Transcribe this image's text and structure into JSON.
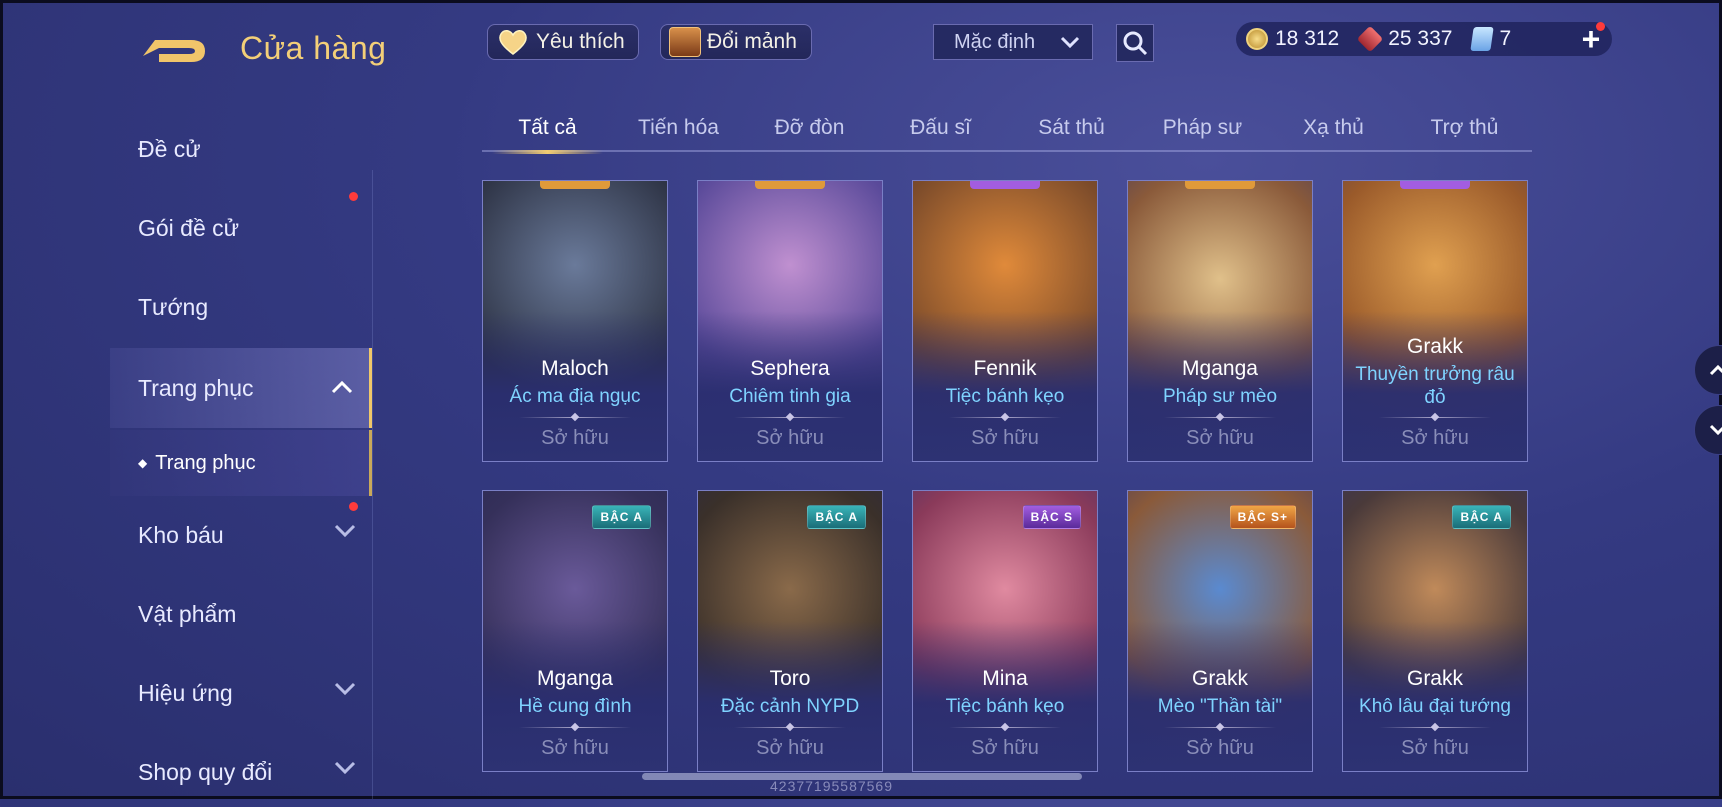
{
  "header": {
    "title": "Cửa hàng",
    "favorites_label": "Yêu thích",
    "exchange_label": "Đổi mảnh",
    "sort_label": "Mặc định"
  },
  "currency": {
    "gold": "18 312",
    "gems": "25 337",
    "vouchers": "7"
  },
  "sidebar": {
    "items": [
      {
        "label": "Đề cử"
      },
      {
        "label": "Gói đề cử"
      },
      {
        "label": "Tướng"
      },
      {
        "label": "Trang phục"
      },
      {
        "label": "Kho báu"
      },
      {
        "label": "Vật phẩm"
      },
      {
        "label": "Hiệu ứng"
      },
      {
        "label": "Shop quy đổi"
      }
    ],
    "sub_item": "Trang phục"
  },
  "tabs": [
    "Tất cả",
    "Tiến hóa",
    "Đỡ đòn",
    "Đấu sĩ",
    "Sát thủ",
    "Pháp sư",
    "Xạ thủ",
    "Trợ thủ"
  ],
  "cards": [
    {
      "hero": "Maloch",
      "skin": "Ác ma địa ngục",
      "status": "Sở hữu",
      "badge": ""
    },
    {
      "hero": "Sephera",
      "skin": "Chiêm tinh gia",
      "status": "Sở hữu",
      "badge": ""
    },
    {
      "hero": "Fennik",
      "skin": "Tiệc bánh kẹo",
      "status": "Sở hữu",
      "badge": ""
    },
    {
      "hero": "Mganga",
      "skin": "Pháp sư mèo",
      "status": "Sở hữu",
      "badge": ""
    },
    {
      "hero": "Grakk",
      "skin": "Thuyền trưởng râu đỏ",
      "status": "Sở hữu",
      "badge": ""
    },
    {
      "hero": "Mganga",
      "skin": "Hề cung đình",
      "status": "Sở hữu",
      "badge": "BẬC A"
    },
    {
      "hero": "Toro",
      "skin": "Đặc cảnh NYPD",
      "status": "Sở hữu",
      "badge": "BẬC A"
    },
    {
      "hero": "Mina",
      "skin": "Tiệc bánh kẹo",
      "status": "Sở hữu",
      "badge": "BẬC S"
    },
    {
      "hero": "Grakk",
      "skin": "Mèo \"Thần tài\"",
      "status": "Sở hữu",
      "badge": "BẬC S+"
    },
    {
      "hero": "Grakk",
      "skin": "Khô lâu đại tướng",
      "status": "Sở hữu",
      "badge": "BẬC A"
    }
  ],
  "footer": {
    "uid": "42377195587569"
  },
  "colors": {
    "accent_gold": "#f3cf78",
    "skin_name": "#7fd3ff",
    "badge_a": "#2a9aa2",
    "badge_s": "#8a47c8",
    "badge_splus": "#e08a3a"
  }
}
